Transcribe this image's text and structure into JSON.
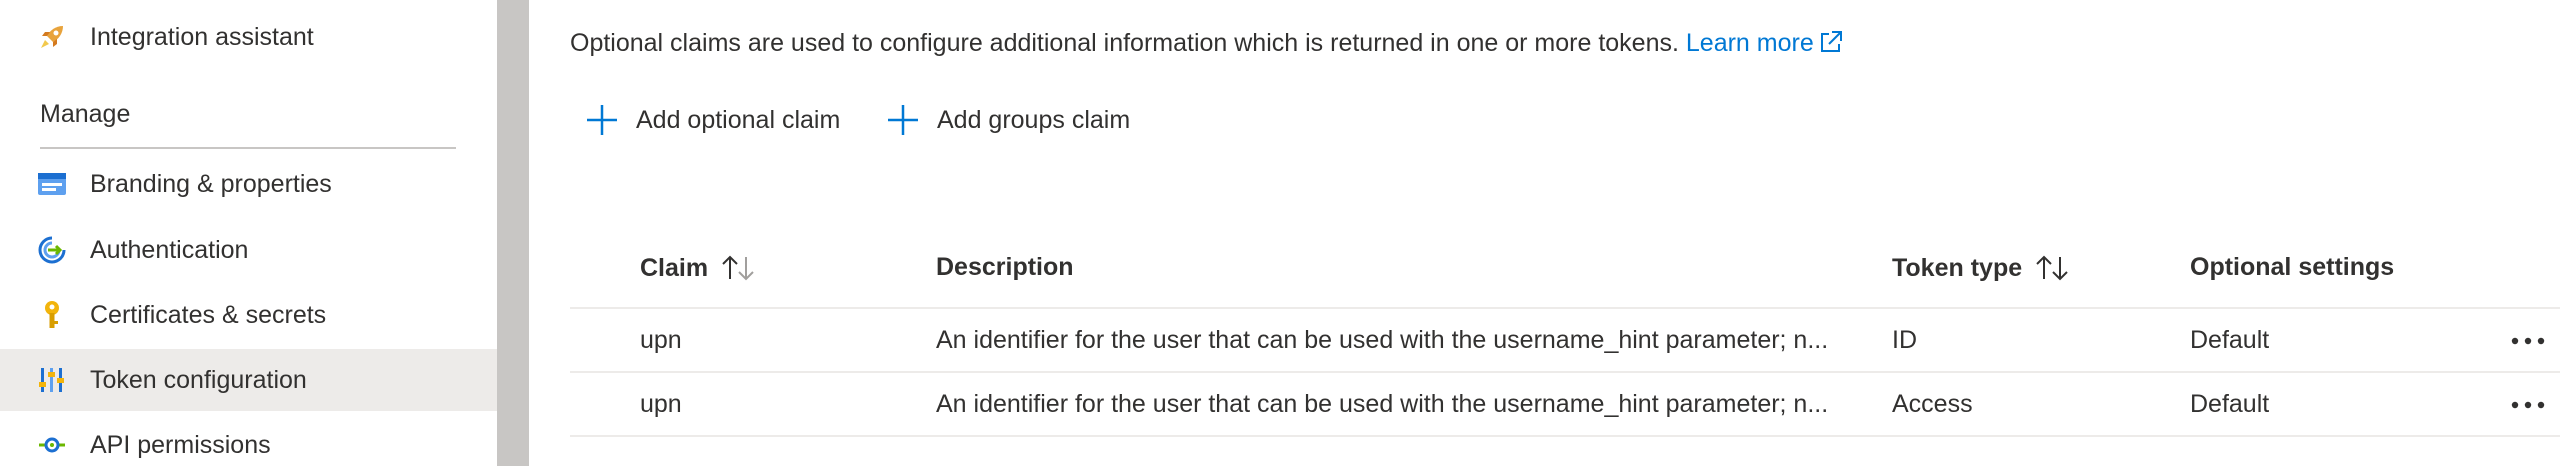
{
  "sidebar": {
    "top_item": {
      "label": "Integration assistant",
      "icon": "rocket-icon"
    },
    "section_header": "Manage",
    "items": [
      {
        "label": "Branding & properties",
        "icon": "branding-icon"
      },
      {
        "label": "Authentication",
        "icon": "authentication-icon"
      },
      {
        "label": "Certificates & secrets",
        "icon": "key-icon"
      },
      {
        "label": "Token configuration",
        "icon": "token-config-icon",
        "active": true
      },
      {
        "label": "API permissions",
        "icon": "api-permissions-icon"
      }
    ]
  },
  "main": {
    "intro_text": "Optional claims are used to configure additional information which is returned in one or more tokens.",
    "learn_more": "Learn more",
    "commands": {
      "add_optional_claim": "Add optional claim",
      "add_groups_claim": "Add groups claim"
    },
    "table": {
      "headers": {
        "claim": "Claim",
        "description": "Description",
        "token_type": "Token type",
        "optional_settings": "Optional settings"
      },
      "rows": [
        {
          "claim": "upn",
          "description": "An identifier for the user that can be used with the username_hint parameter; n...",
          "token_type": "ID",
          "optional_settings": "Default"
        },
        {
          "claim": "upn",
          "description": "An identifier for the user that can be used with the username_hint parameter; n...",
          "token_type": "Access",
          "optional_settings": "Default"
        }
      ]
    }
  },
  "colors": {
    "accent": "#0078d4",
    "active_bg": "#edebe9",
    "divider": "#c8c6c4",
    "text": "#323130"
  }
}
